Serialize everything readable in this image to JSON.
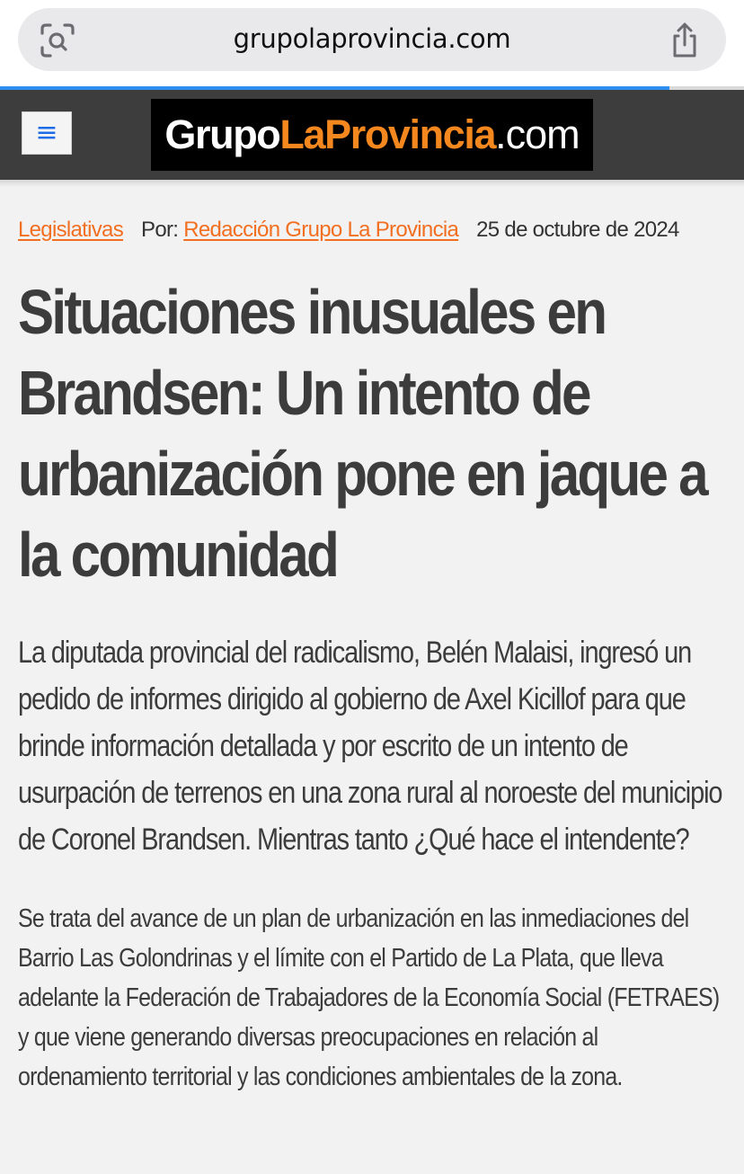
{
  "browser": {
    "url": "grupolaprovincia.com",
    "lens_icon": "visual-search-icon",
    "share_icon": "share-icon",
    "load_progress": 0.9
  },
  "site": {
    "menu_icon": "≡",
    "logo": {
      "part1": "Grupo",
      "part2": "LaProvincia",
      "part3": ".com"
    },
    "colors": {
      "header_bg": "#3d3d3d",
      "accent": "#f26f21",
      "menu_icon": "#1e6be8"
    }
  },
  "article": {
    "category": "Legislativas",
    "by_label": "Por:",
    "author": "Redacción Grupo La Provincia",
    "date": "25 de octubre de 2024",
    "title": "Situaciones inusuales en Brandsen: Un intento de urbanización pone en jaque a la comunidad",
    "lead": "La diputada provincial del radicalismo, Belén Malaisi, ingresó un pedido de informes dirigido al gobierno de Axel Kicillof para que brinde información detallada y por escrito de un intento de usurpación de terrenos en una zona rural al noroeste del municipio de Coronel Brandsen. Mientras tanto ¿Qué hace el intendente?",
    "paragraphs": [
      "Se trata del avance de un plan de urbanización en las inmediaciones del Barrio Las Golondrinas y el límite con el Partido de La Plata, que lleva adelante la Federación de Trabajadores de la Economía Social (FETRAES) y que viene generando diversas preocupaciones en relación al ordenamiento territorial y las condiciones ambientales de la zona."
    ]
  }
}
